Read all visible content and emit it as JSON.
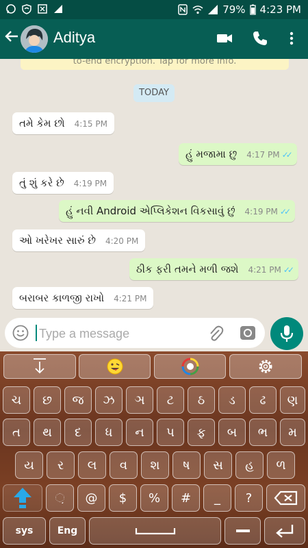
{
  "status_bar": {
    "battery": "79%",
    "time": "4:23 PM"
  },
  "header": {
    "contact_name": "Aditya"
  },
  "chat": {
    "encryption_notice": "to-end encryption. Tap for more info.",
    "date_divider": "TODAY",
    "messages": [
      {
        "direction": "in",
        "text": "તમે કેમ છો",
        "time": "4:15 PM"
      },
      {
        "direction": "out",
        "text": "હું મજામા છુ",
        "time": "4:17 PM",
        "ticks": "✓✓"
      },
      {
        "direction": "in",
        "text": "તું શું કરે છે",
        "time": "4:19 PM"
      },
      {
        "direction": "out",
        "text": "હું નવી Android એપ્લિકેશન વિકસાવું છું",
        "time": "4:19 PM",
        "ticks": "✓✓"
      },
      {
        "direction": "in",
        "text": "ઓ ખરેખર સારું છે",
        "time": "4:20 PM"
      },
      {
        "direction": "out",
        "text": "ઠીક ફરી તમને મળી જશે",
        "time": "4:21 PM",
        "ticks": "✓✓"
      },
      {
        "direction": "in",
        "text": "બરાબર કાળજી રાખો",
        "time": "4:21 PM"
      }
    ]
  },
  "composer": {
    "placeholder": "Type a message"
  },
  "keyboard": {
    "row1": [
      "ચ",
      "છ",
      "જ",
      "ઝ",
      "ઞ",
      "ટ",
      "ઠ",
      "ડ",
      "ઢ",
      "ણ"
    ],
    "row2": [
      "ત",
      "થ",
      "દ",
      "ધ",
      "ન",
      "પ",
      "ફ",
      "બ",
      "ભ",
      "મ"
    ],
    "row3": [
      "ય",
      "ર",
      "લ",
      "વ",
      "શ",
      "ષ",
      "સ",
      "હ",
      "ળ"
    ],
    "row4": [
      "઼",
      "@",
      "$",
      "%",
      "#",
      "_",
      "?"
    ],
    "sys_label": "sys",
    "lang_label": "Eng"
  },
  "colors": {
    "header": "#075e54",
    "status_bar": "#054d44",
    "outgoing_bubble": "#dcf8c6",
    "incoming_bubble": "#ffffff",
    "mic_button": "#00897b",
    "read_ticks": "#4fc3f7",
    "shift_arrow": "#29a9e8"
  }
}
